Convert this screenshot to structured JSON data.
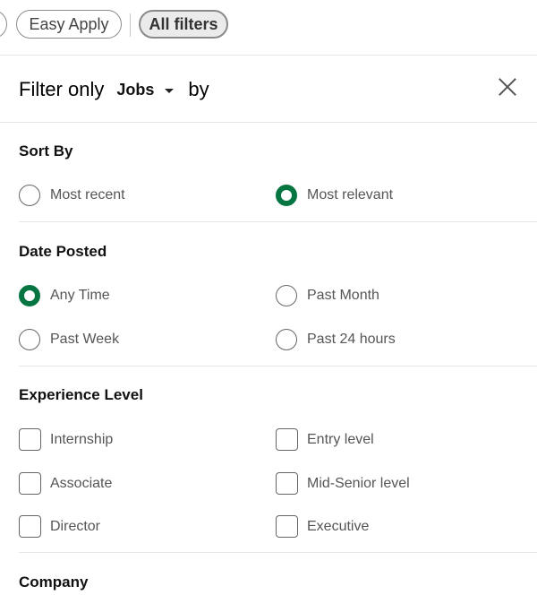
{
  "pills": {
    "easy_apply": "Easy Apply",
    "all_filters": "All filters"
  },
  "header": {
    "filter_only": "Filter only",
    "type": "Jobs",
    "by": "by"
  },
  "sort_by": {
    "title": "Sort By",
    "options": [
      {
        "label": "Most recent",
        "selected": false
      },
      {
        "label": "Most relevant",
        "selected": true
      }
    ]
  },
  "date_posted": {
    "title": "Date Posted",
    "options": [
      {
        "label": "Any Time",
        "selected": true
      },
      {
        "label": "Past Month",
        "selected": false
      },
      {
        "label": "Past Week",
        "selected": false
      },
      {
        "label": "Past 24 hours",
        "selected": false
      }
    ]
  },
  "experience_level": {
    "title": "Experience Level",
    "options": [
      {
        "label": "Internship",
        "checked": false
      },
      {
        "label": "Entry level",
        "checked": false
      },
      {
        "label": "Associate",
        "checked": false
      },
      {
        "label": "Mid-Senior level",
        "checked": false
      },
      {
        "label": "Director",
        "checked": false
      },
      {
        "label": "Executive",
        "checked": false
      }
    ]
  },
  "company": {
    "title": "Company"
  },
  "colors": {
    "accent": "#057642"
  }
}
